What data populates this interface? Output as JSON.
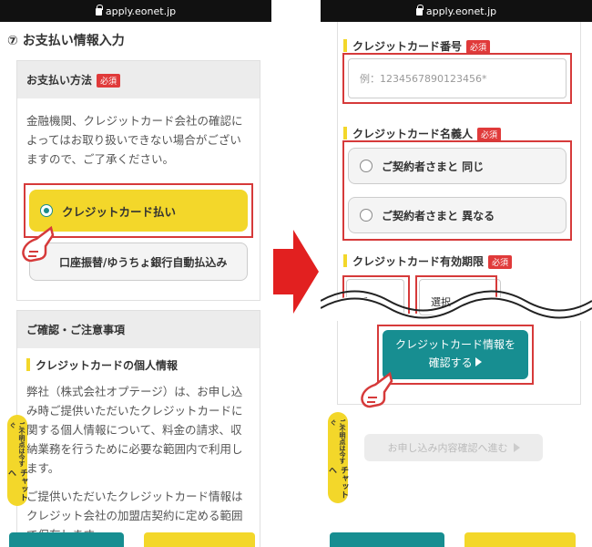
{
  "colors": {
    "accent_red": "#e03a3a",
    "yellow": "#f3d72a",
    "teal": "#178e91",
    "highlight_box": "#d63a3a"
  },
  "left": {
    "url": "apply.eonet.jp",
    "section_title": "⑦ お支払い情報入力",
    "payment": {
      "heading": "お支払い方法",
      "badge": "必須",
      "desc": "金融機関、クレジットカード会社の確認によってはお取り扱いできない場合がございますので、ご了承ください。",
      "option_credit": "クレジットカード払い",
      "option_bank": "口座振替/ゆうちょ銀行自動払込み"
    },
    "notice": {
      "heading": "ご確認・ご注意事項",
      "sub_heading": "クレジットカードの個人情報",
      "para1": "弊社（株式会社オプテージ）は、お申し込み時ご提供いただいたクレジットカードに関する個人情報について、料金の請求、収納業務を行うために必要な範囲内で利用します。",
      "para2": "ご提供いただいたクレジットカード情報はクレジット会社の加盟店契約に定める範囲で保存します"
    },
    "chat_tab": {
      "small": "ご不明点は今すぐ",
      "label": "チャットへ"
    }
  },
  "right": {
    "url": "apply.eonet.jp",
    "card_number": {
      "label": "クレジットカード番号",
      "badge": "必須",
      "placeholder": "例：1234567890123456*"
    },
    "card_holder": {
      "label": "クレジットカード名義人",
      "badge": "必須",
      "option_same": "ご契約者さまと 同じ",
      "option_diff": "ご契約者さまと 異なる"
    },
    "expiry": {
      "label": "クレジットカード有効期限",
      "badge": "必須",
      "month_select": "選",
      "year_select": "選択"
    },
    "confirm_button": {
      "line1": "クレジットカード情報を",
      "line2": "確認する"
    },
    "proceed_button": "お申し込み内容確認へ進む",
    "chat_tab": {
      "small": "ご不明点は今すぐ",
      "label": "チャットへ"
    }
  }
}
